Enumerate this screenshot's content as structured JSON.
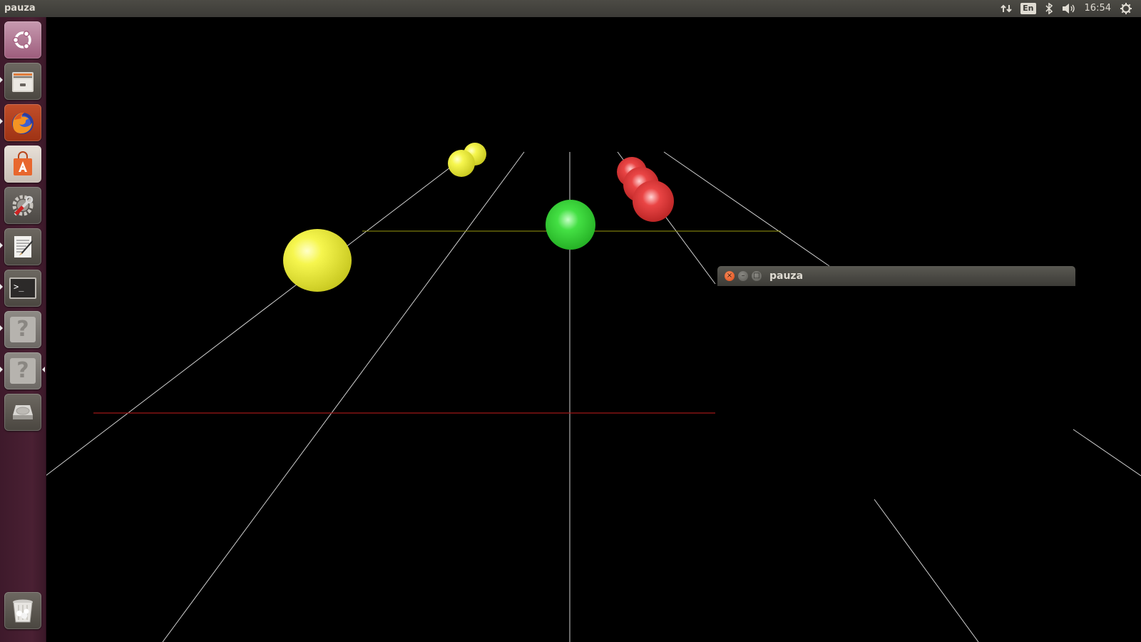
{
  "top_panel": {
    "app_title": "pauza",
    "keyboard_layout": "En",
    "clock": "16:54",
    "indicators": [
      "network-transfer-icon",
      "keyboard-layout-indicator",
      "bluetooth-icon",
      "volume-icon",
      "clock",
      "system-gear-icon"
    ]
  },
  "launcher": {
    "items": [
      {
        "name": "ubuntu-dash",
        "icon": "ubuntu-logo-icon"
      },
      {
        "name": "files",
        "icon": "file-cabinet-icon"
      },
      {
        "name": "firefox",
        "icon": "firefox-icon"
      },
      {
        "name": "software-center",
        "icon": "shopping-bag-icon"
      },
      {
        "name": "system-settings",
        "icon": "settings-tools-icon"
      },
      {
        "name": "text-editor",
        "icon": "text-editor-icon"
      },
      {
        "name": "terminal",
        "icon": "terminal-icon"
      },
      {
        "name": "unknown-app-1",
        "icon": "question-mark-icon"
      },
      {
        "name": "unknown-app-2",
        "icon": "question-mark-icon"
      },
      {
        "name": "drive",
        "icon": "hard-drive-icon"
      },
      {
        "name": "trash",
        "icon": "trash-icon"
      }
    ],
    "terminal_prompt": ">_",
    "unknown_glyph": "?"
  },
  "window": {
    "title": "pauza",
    "close_glyph": "×",
    "minimize_glyph": "–",
    "maximize_glyph": "□"
  },
  "scene": {
    "background": "#000000",
    "sphere_colors": {
      "yellow": "#f2f24a",
      "green": "#33dd33",
      "red": "#e83838"
    },
    "line_colors": {
      "track": "#cfcfcf",
      "yellow_line": "#9a9a10",
      "red_line": "#a01818"
    }
  }
}
